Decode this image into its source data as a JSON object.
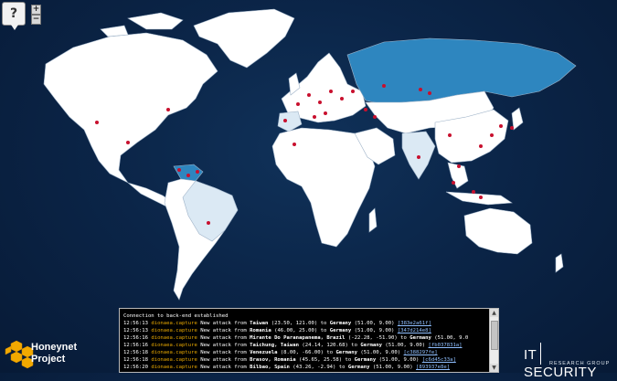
{
  "controls": {
    "help_label": "?",
    "zoom_in_label": "+",
    "zoom_out_label": "−"
  },
  "colors": {
    "ocean": "#0b2548",
    "land": "#ffffff",
    "land_attacker_light": "#dbe9f4",
    "land_attacker_dark": "#2e86bf",
    "attack_dot": "#c8102e"
  },
  "console": {
    "header": "Connection to back-end established",
    "lines": [
      {
        "time": "12:56:13",
        "source": "dionaea.capture",
        "msg": " New attack from ",
        "from": "Taiwan",
        "from_coords": " (23.50, 121.00) ",
        "to": "Germany",
        "to_coords": " (51.00, 9.00) ",
        "id": "[383e2a61f]"
      },
      {
        "time": "12:56:13",
        "source": "dionaea.capture",
        "msg": " New attack from ",
        "from": "Romania",
        "from_coords": " (46.00, 25.00) ",
        "to": "Germany",
        "to_coords": " (51.00, 9.00) ",
        "id": "[347d214e8]"
      },
      {
        "time": "12:56:16",
        "source": "dionaea.capture",
        "msg": " New attack from ",
        "from": "Mirante Do Paranapanema, Brazil",
        "from_coords": " (-22.28, -51.90) ",
        "to": "Germany",
        "to_coords": " (51.00, 9.0",
        "id": ""
      },
      {
        "time": "12:56:16",
        "source": "dionaea.capture",
        "msg": " New attack from ",
        "from": "Taichung, Taiwan",
        "from_coords": " (24.14, 120.68) ",
        "to": "Germany",
        "to_coords": " (51.00, 9.00) ",
        "id": "[fb037831a]"
      },
      {
        "time": "12:56:18",
        "source": "dionaea.capture",
        "msg": " New attack from ",
        "from": "Venezuela",
        "from_coords": " (8.00, -66.00) ",
        "to": "Germany",
        "to_coords": " (51.00, 9.00) ",
        "id": "[c388297fe]"
      },
      {
        "time": "12:56:18",
        "source": "dionaea.capture",
        "msg": " New attack from ",
        "from": "Brasov, Romania",
        "from_coords": " (45.65, 25.58) ",
        "to": "Germany",
        "to_coords": " (51.00, 9.00) ",
        "id": "[c6d45c33a]"
      },
      {
        "time": "12:56:20",
        "source": "dionaea.capture",
        "msg": " New attack from ",
        "from": "Bilbao, Spain",
        "from_coords": " (43.26, -2.94) ",
        "to": "Germany",
        "to_coords": " (51.00, 9.00) ",
        "id": "[893937e8e]"
      }
    ]
  },
  "branding": {
    "honeynet_line1": "Honeynet",
    "honeynet_line2": "Project",
    "its_main": "IT",
    "its_secondary": "SECURITY",
    "its_sub": "RESEARCH GROUP"
  }
}
